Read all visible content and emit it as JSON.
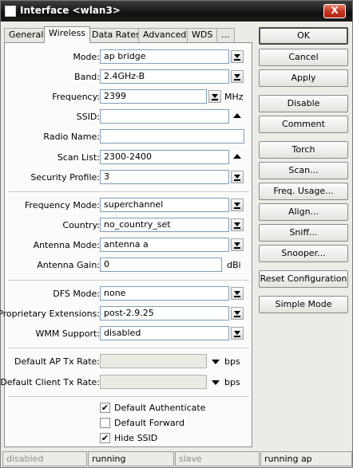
{
  "window": {
    "title": "Interface <wlan3>",
    "close_glyph": "X"
  },
  "tabs": [
    "General",
    "Wireless",
    "Data Rates",
    "Advanced",
    "WDS",
    "..."
  ],
  "fields": {
    "mode": {
      "label": "Mode:",
      "value": "ap bridge"
    },
    "band": {
      "label": "Band:",
      "value": "2.4GHz-B"
    },
    "frequency": {
      "label": "Frequency:",
      "value": "2399",
      "unit": "MHz"
    },
    "ssid": {
      "label": "SSID:",
      "value": ""
    },
    "radio_name": {
      "label": "Radio Name:",
      "value": ""
    },
    "scan_list": {
      "label": "Scan List:",
      "value": "2300-2400"
    },
    "security_profile": {
      "label": "Security Profile:",
      "value": "3"
    },
    "frequency_mode": {
      "label": "Frequency Mode:",
      "value": "superchannel"
    },
    "country": {
      "label": "Country:",
      "value": "no_country_set"
    },
    "antenna_mode": {
      "label": "Antenna Mode:",
      "value": "antenna a"
    },
    "antenna_gain": {
      "label": "Antenna Gain:",
      "value": "0",
      "unit": "dBi"
    },
    "dfs_mode": {
      "label": "DFS Mode:",
      "value": "none"
    },
    "proprietary_extensions": {
      "label": "Proprietary Extensions:",
      "value": "post-2.9.25"
    },
    "wmm_support": {
      "label": "WMM Support:",
      "value": "disabled"
    },
    "default_ap_tx_rate": {
      "label": "Default AP Tx Rate:",
      "value": "",
      "unit": "bps"
    },
    "default_client_tx_rate": {
      "label": "Default Client Tx Rate:",
      "value": "",
      "unit": "bps"
    }
  },
  "checkboxes": [
    {
      "label": "Default Authenticate",
      "checked": true,
      "mark": "✔"
    },
    {
      "label": "Default Forward",
      "checked": false,
      "mark": ""
    },
    {
      "label": "Hide SSID",
      "checked": true,
      "mark": "✔"
    }
  ],
  "buttons": {
    "ok": "OK",
    "cancel": "Cancel",
    "apply": "Apply",
    "disable": "Disable",
    "comment": "Comment",
    "torch": "Torch",
    "scan": "Scan...",
    "freq_usage": "Freq. Usage...",
    "align": "Align...",
    "sniff": "Sniff...",
    "snooper": "Snooper...",
    "reset_configuration": "Reset Configuration",
    "simple_mode": "Simple Mode"
  },
  "status": [
    "disabled",
    "running",
    "slave",
    "running ap"
  ]
}
